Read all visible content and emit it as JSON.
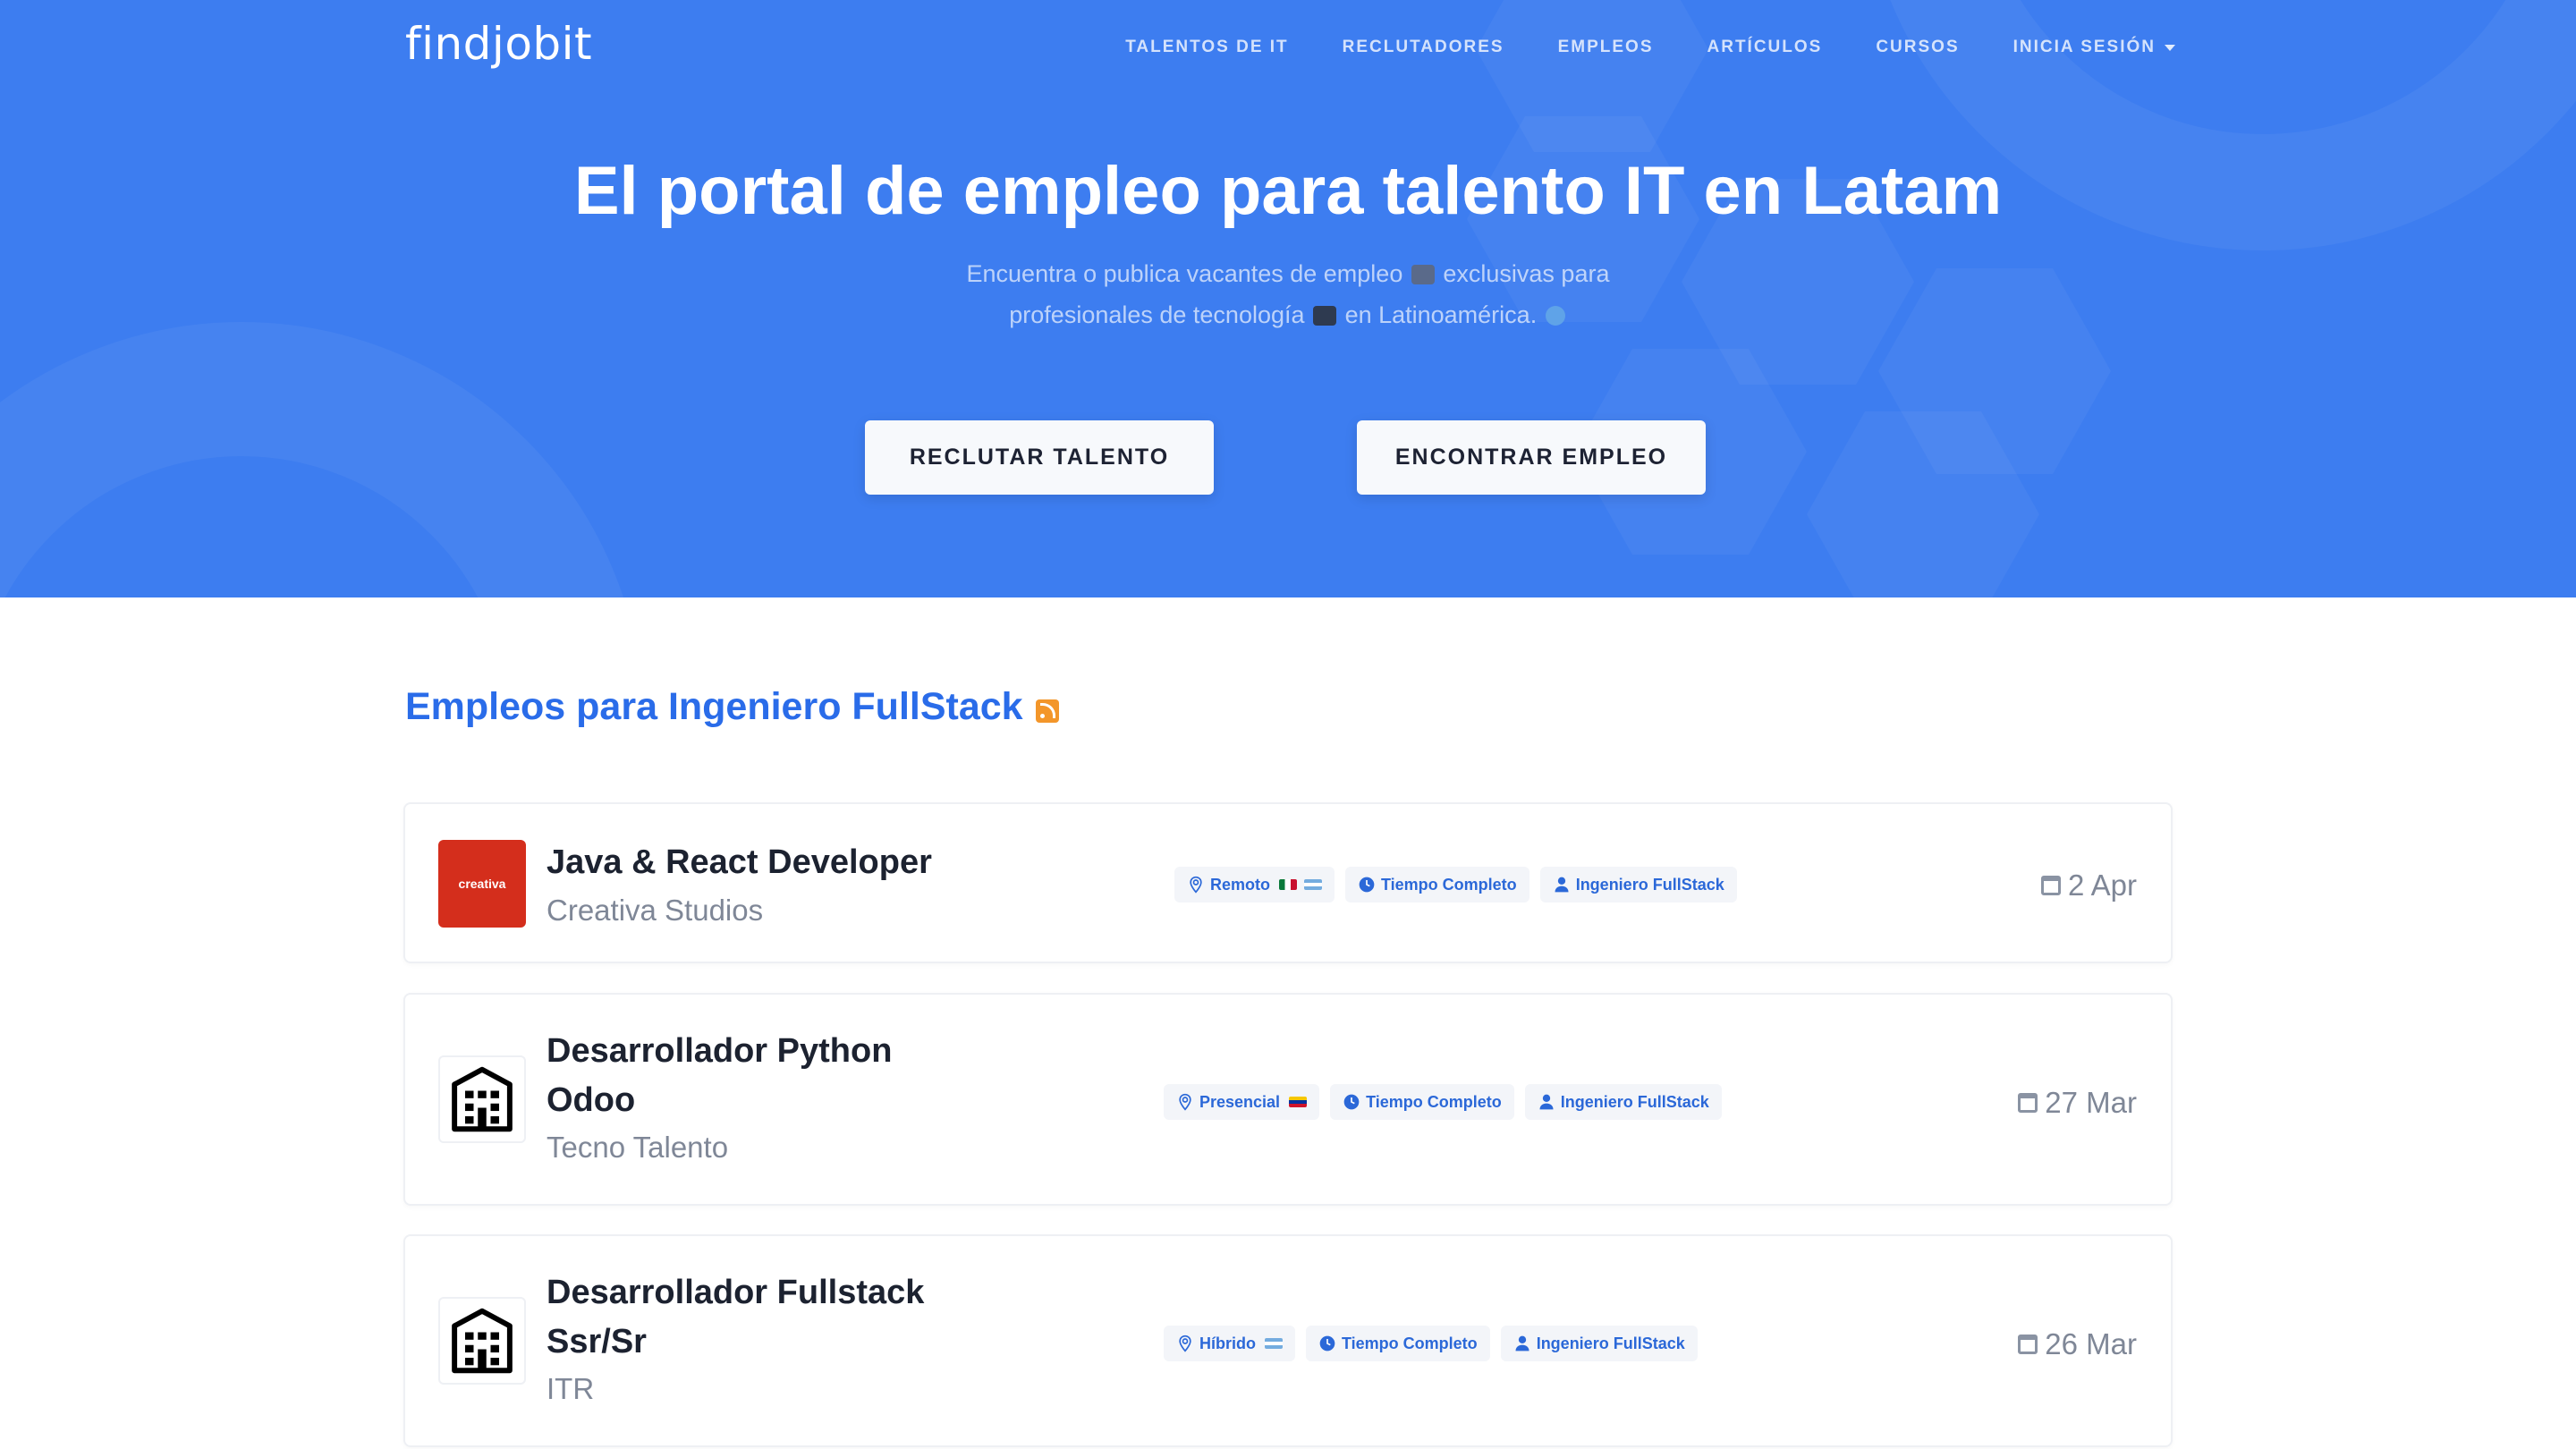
{
  "brand": {
    "logo_text": "findjobit"
  },
  "nav": {
    "items": [
      {
        "label": "TALENTOS DE IT"
      },
      {
        "label": "RECLUTADORES"
      },
      {
        "label": "EMPLEOS"
      },
      {
        "label": "ARTÍCULOS"
      },
      {
        "label": "CURSOS"
      },
      {
        "label": "INICIA SESIÓN",
        "icon": "caret-down-icon"
      }
    ]
  },
  "hero": {
    "title": "El portal de empleo para talento IT en Latam",
    "subtitle_line1_a": "Encuentra o publica vacantes de empleo",
    "subtitle_line1_b": "exclusivas para",
    "subtitle_line2_a": "profesionales de tecnología",
    "subtitle_line2_b": "en Latinoamérica.",
    "emoji_icons": [
      "briefcase-emoji-icon",
      "laptop-emoji-icon",
      "globe-emoji-icon"
    ],
    "buttons": {
      "recruit": "RECLUTAR TALENTO",
      "find": "ENCONTRAR EMPLEO"
    },
    "background_color": "#3d7df0"
  },
  "section": {
    "title": "Empleos para Ingeniero FullStack",
    "icon": "rss-feed-icon",
    "accent_color": "#2a6ce9"
  },
  "jobs": [
    {
      "title_line1": "Java & React Developer",
      "title_line2": "",
      "company": "Creativa Studios",
      "logo_text": "creativa",
      "tags": [
        {
          "label": "Remoto",
          "icon": "location-pin-icon",
          "flags": [
            "mexico-flag-icon",
            "argentina-flag-icon"
          ]
        },
        {
          "label": "Tiempo Completo",
          "icon": "clock-icon"
        },
        {
          "label": "Ingeniero FullStack",
          "icon": "user-icon"
        }
      ],
      "date": "2 Apr"
    },
    {
      "title_line1": "Desarrollador Python",
      "title_line2": "Odoo",
      "company": "Tecno Talento",
      "logo_icon": "building-icon",
      "tags": [
        {
          "label": "Presencial",
          "icon": "location-pin-icon",
          "flags": [
            "venezuela-flag-icon"
          ]
        },
        {
          "label": "Tiempo Completo",
          "icon": "clock-icon"
        },
        {
          "label": "Ingeniero FullStack",
          "icon": "user-icon"
        }
      ],
      "date": "27 Mar"
    },
    {
      "title_line1": "Desarrollador Fullstack",
      "title_line2": "Ssr/Sr",
      "company": "ITR",
      "logo_icon": "building-icon",
      "tags": [
        {
          "label": "Híbrido",
          "icon": "location-pin-icon",
          "flags": [
            "argentina-flag-icon"
          ]
        },
        {
          "label": "Tiempo Completo",
          "icon": "clock-icon"
        },
        {
          "label": "Ingeniero FullStack",
          "icon": "user-icon"
        }
      ],
      "date": "26 Mar"
    }
  ]
}
